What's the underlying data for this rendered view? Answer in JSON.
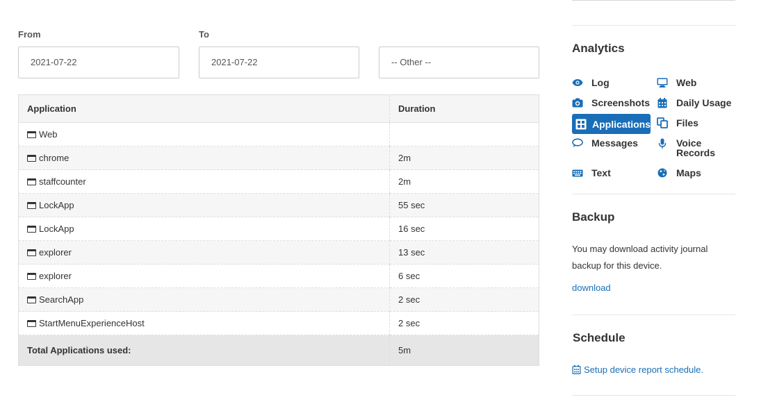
{
  "filters": {
    "from_label": "From",
    "to_label": "To",
    "from_value": "2021-07-22",
    "to_value": "2021-07-22",
    "other_value": "-- Other --"
  },
  "table": {
    "headers": [
      "Application",
      "Duration"
    ],
    "rows": [
      {
        "app": "Web",
        "duration": ""
      },
      {
        "app": "chrome",
        "duration": "2m"
      },
      {
        "app": "staffcounter",
        "duration": "2m"
      },
      {
        "app": "LockApp",
        "duration": "55 sec"
      },
      {
        "app": "LockApp",
        "duration": "16 sec"
      },
      {
        "app": "explorer",
        "duration": "13 sec"
      },
      {
        "app": "explorer",
        "duration": "6 sec"
      },
      {
        "app": "SearchApp",
        "duration": "2 sec"
      },
      {
        "app": "StartMenuExperienceHost",
        "duration": "2 sec"
      }
    ],
    "total_label": "Total Applications used:",
    "total_value": "5m"
  },
  "sidebar": {
    "analytics_title": "Analytics",
    "nav": {
      "log": "Log",
      "web": "Web",
      "screenshots": "Screenshots",
      "daily_usage": "Daily Usage",
      "applications": "Applications",
      "files": "Files",
      "messages": "Messages",
      "voice_records_1": "Voice",
      "voice_records_2": "Records",
      "text": "Text",
      "maps": "Maps"
    },
    "backup_title": "Backup",
    "backup_text": "You may download activity journal backup for this device.",
    "download_link": "download",
    "schedule_title": "Schedule",
    "schedule_link": "Setup device report schedule."
  },
  "colors": {
    "accent": "#1a6eb7",
    "text": "#333333",
    "border": "#dddddd"
  }
}
